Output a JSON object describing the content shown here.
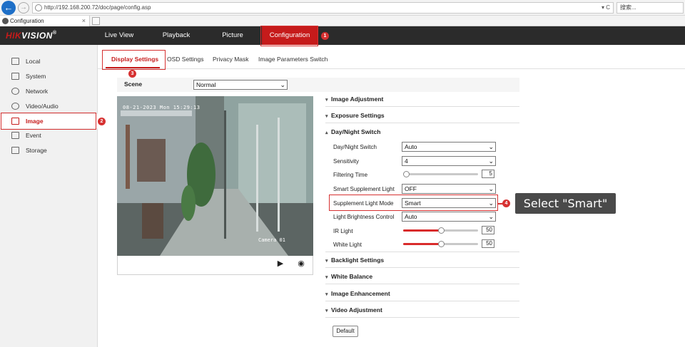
{
  "browser": {
    "url": "http://192.168.200.72/doc/page/config.asp",
    "url_controls": "▾ C",
    "search_placeholder": "搜索...",
    "tab_title": "Configuration",
    "tab_close": "×"
  },
  "header": {
    "logo_red": "HIK",
    "logo_white": "VISION",
    "logo_mark": "®",
    "nav": [
      {
        "label": "Live View"
      },
      {
        "label": "Playback"
      },
      {
        "label": "Picture"
      },
      {
        "label": "Configuration"
      }
    ]
  },
  "sidebar": {
    "items": [
      {
        "label": "Local"
      },
      {
        "label": "System"
      },
      {
        "label": "Network"
      },
      {
        "label": "Video/Audio"
      },
      {
        "label": "Image"
      },
      {
        "label": "Event"
      },
      {
        "label": "Storage"
      }
    ]
  },
  "subtabs": [
    {
      "label": "Display Settings"
    },
    {
      "label": "OSD Settings"
    },
    {
      "label": "Privacy Mask"
    },
    {
      "label": "Image Parameters Switch"
    }
  ],
  "scene": {
    "label": "Scene",
    "value": "Normal"
  },
  "video": {
    "osd_time": "08-21-2023 Mon 15:29:13",
    "osd_camera": "Camera 01",
    "record_icon": "video-camera-icon",
    "snapshot_icon": "camera-icon"
  },
  "sections": {
    "image_adjustment": "Image Adjustment",
    "exposure_settings": "Exposure Settings",
    "day_night_switch": "Day/Night Switch",
    "backlight_settings": "Backlight Settings",
    "white_balance": "White Balance",
    "image_enhancement": "Image Enhancement",
    "video_adjustment": "Video Adjustment",
    "collapsed_chevron": "▾",
    "expanded_chevron": "▴"
  },
  "day_night": {
    "switch": {
      "label": "Day/Night Switch",
      "value": "Auto"
    },
    "sensitivity": {
      "label": "Sensitivity",
      "value": "4"
    },
    "filtering_time": {
      "label": "Filtering Time",
      "value": "5",
      "level": 0
    },
    "smart_supplement": {
      "label": "Smart Supplement Light",
      "value": "OFF"
    },
    "supplement_mode": {
      "label": "Supplement Light Mode",
      "value": "Smart"
    },
    "brightness_control": {
      "label": "Light Brightness Control",
      "value": "Auto"
    },
    "ir_light": {
      "label": "IR Light",
      "value": "50",
      "level": 0.5
    },
    "white_light": {
      "label": "White Light",
      "value": "50",
      "level": 0.5
    }
  },
  "default_button": "Default",
  "annotations": {
    "badges": [
      "1",
      "2",
      "3",
      "4"
    ],
    "callout": "Select \"Smart\""
  },
  "colors": {
    "accent": "#c61b1b",
    "annotation": "#d63131",
    "header_bg": "#2b2b2b"
  }
}
